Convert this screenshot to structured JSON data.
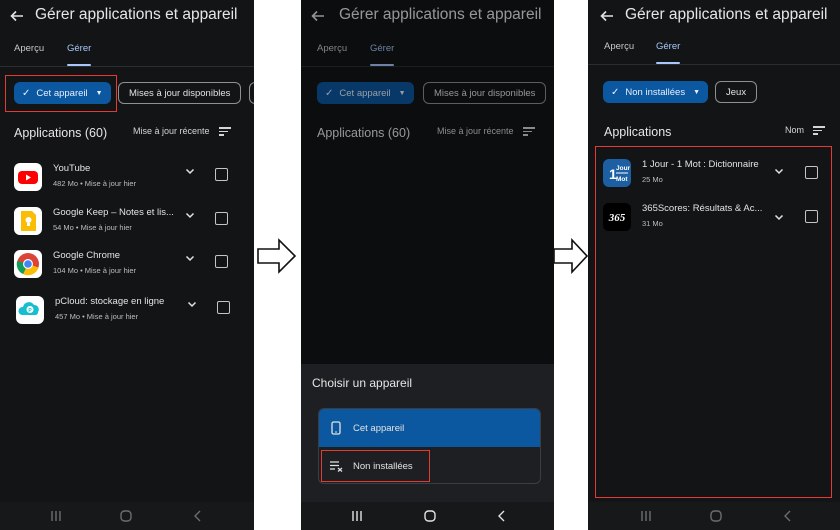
{
  "colors": {
    "background": "#131416",
    "chip_selected": "#0b57a0",
    "accent": "#a8c7fa",
    "highlight": "#e53935"
  },
  "screen1": {
    "title": "Gérer applications et appareil",
    "tabs": [
      "Aperçu",
      "Gérer"
    ],
    "active_tab": "Gérer",
    "filter_chips": [
      "Cet appareil",
      "Mises à jour disponibles"
    ],
    "section_title": "Applications (60)",
    "sort_label": "Mise à jour récente",
    "apps": [
      {
        "name": "YouTube",
        "meta": "482 Mo • Mise à jour hier",
        "icon": "youtube-icon"
      },
      {
        "name": "Google Keep – Notes et lis...",
        "meta": "54 Mo • Mise à jour hier",
        "icon": "google-keep-icon"
      },
      {
        "name": "Google Chrome",
        "meta": "104 Mo • Mise à jour hier",
        "icon": "chrome-icon"
      },
      {
        "name": "pCloud: stockage en ligne",
        "meta": "457 Mo • Mise à jour hier",
        "icon": "pcloud-icon"
      }
    ]
  },
  "screen2": {
    "title": "Gérer applications et appareil",
    "tabs": [
      "Aperçu",
      "Gérer"
    ],
    "filter_chips": [
      "Cet appareil",
      "Mises à jour disponibles"
    ],
    "section_title": "Applications (60)",
    "sort_label": "Mise à jour récente",
    "sheet_title": "Choisir un appareil",
    "options": [
      {
        "label": "Cet appareil",
        "icon": "phone-icon",
        "selected": true
      },
      {
        "label": "Non installées",
        "icon": "list-remove-icon",
        "selected": false
      }
    ]
  },
  "screen3": {
    "title": "Gérer applications et appareil",
    "tabs": [
      "Aperçu",
      "Gérer"
    ],
    "active_tab": "Gérer",
    "filter_chips": [
      "Non installées",
      "Jeux"
    ],
    "section_title": "Applications",
    "sort_label": "Nom",
    "apps": [
      {
        "name": "1 Jour - 1 Mot : Dictionnaire",
        "meta": "25 Mo",
        "icon": "1jour-1mot-icon",
        "icon_text": [
          "1",
          "Jour",
          "Mot"
        ]
      },
      {
        "name": "365Scores: Résultats & Ac...",
        "meta": "31 Mo",
        "icon": "365scores-icon",
        "icon_text": "365"
      }
    ]
  }
}
